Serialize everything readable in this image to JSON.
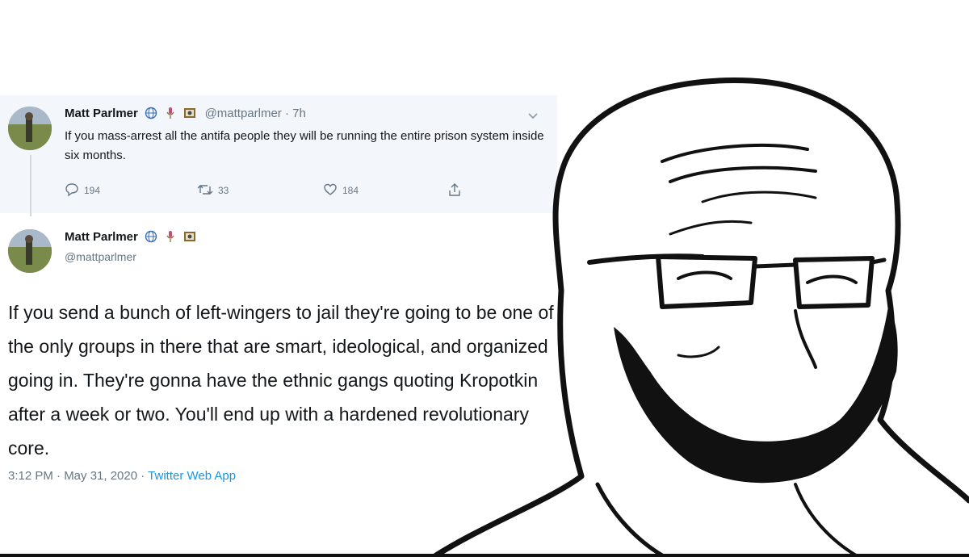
{
  "parent_tweet": {
    "author_name": "Matt Parlmer",
    "handle": "@mattparlmer",
    "time": "7h",
    "text": "If you mass-arrest all the antifa people they will be running the entire prison system inside six months.",
    "replies": "194",
    "retweets": "33",
    "likes": "184"
  },
  "main_tweet": {
    "author_name": "Matt Parlmer",
    "handle": "@mattparlmer",
    "text": "If you send a bunch of left-wingers to jail they're going to be one of the only groups in there that are smart, ideological, and organized going in. They're gonna have the ethnic gangs quoting Kropotkin after a week or two. You'll end up with a hardened revolutionary core.",
    "timestamp": "3:12 PM · May 31, 2020 · ",
    "source_app": "Twitter Web App"
  },
  "icons": [
    "globe-icon",
    "microphone-icon",
    "painting-icon",
    "reply-icon",
    "retweet-icon",
    "like-icon",
    "share-icon",
    "chevron-down-icon"
  ],
  "colors": {
    "parent_bg": "#f3f6fa",
    "muted": "#657786",
    "link": "#1b95e0",
    "text": "#14171a"
  }
}
